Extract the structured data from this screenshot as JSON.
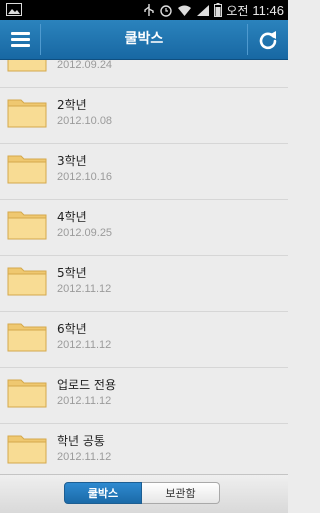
{
  "status_bar": {
    "ampm": "오전",
    "time": "11:46",
    "icons": [
      "image-icon",
      "usb-icon",
      "alarm-icon",
      "wifi-icon",
      "signal-icon",
      "battery-icon"
    ]
  },
  "app_bar": {
    "title": "쿨박스",
    "left_icon": "menu-icon",
    "right_icon": "refresh-icon"
  },
  "folders": [
    {
      "name": "",
      "date": "2012.09.24"
    },
    {
      "name": "2학년",
      "date": "2012.10.08"
    },
    {
      "name": "3학년",
      "date": "2012.10.16"
    },
    {
      "name": "4학년",
      "date": "2012.09.25"
    },
    {
      "name": "5학년",
      "date": "2012.11.12"
    },
    {
      "name": "6학년",
      "date": "2012.11.12"
    },
    {
      "name": "업로드 전용",
      "date": "2012.11.12"
    },
    {
      "name": "학년 공통",
      "date": "2012.11.12"
    }
  ],
  "bottom_tabs": {
    "active": "쿨박스",
    "inactive": "보관함"
  },
  "colors": {
    "app_bar": "#1f76b3",
    "active_tab": "#2a7fc4",
    "folder": "#f5d98f"
  }
}
